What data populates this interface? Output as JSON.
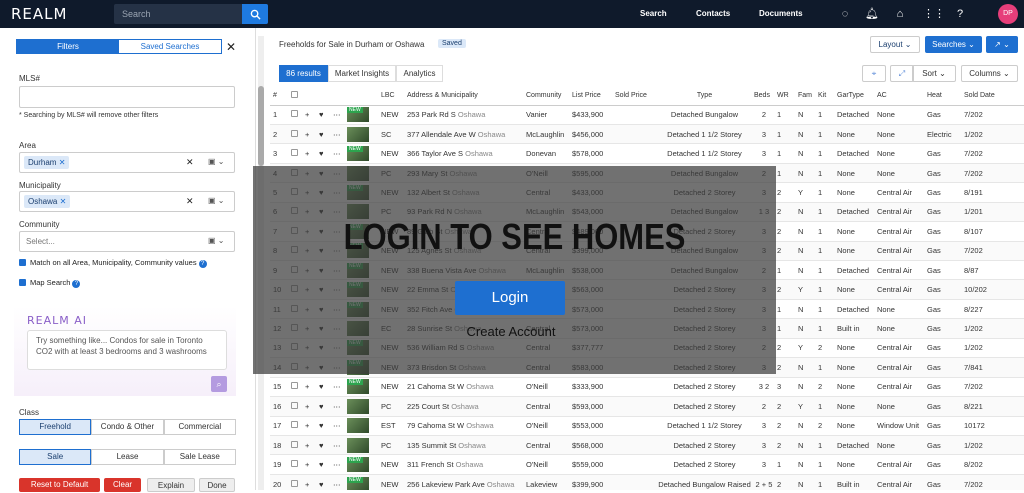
{
  "top": {
    "logo": "REALM",
    "search_placeholder": "Search",
    "nav_search": "Search",
    "nav_contacts": "Contacts",
    "nav_documents": "Documents",
    "avatar": "DP"
  },
  "left": {
    "tab_filters": "Filters",
    "tab_saved": "Saved Searches",
    "mls_label": "MLS#",
    "mls_note": "* Searching by MLS# will remove other filters",
    "area_label": "Area",
    "area_chip": "Durham",
    "muni_label": "Municipality",
    "muni_chip": "Oshawa",
    "community_label": "Community",
    "community_placeholder": "Select...",
    "match_text": "Match on all Area, Municipality, Community values",
    "map_search": "Map Search",
    "ai_logo": "REALM AI",
    "ai_prompt": "Try something like... Condos for sale in Toronto CO2 with at least 3 bedrooms and 3 washrooms",
    "class_label": "Class",
    "class_opts": [
      "Freehold",
      "Condo & Other",
      "Commercial"
    ],
    "sale_opts": [
      "Sale",
      "Lease",
      "Sale Lease"
    ],
    "btn_reset": "Reset to Default",
    "btn_clear": "Clear",
    "btn_explain": "Explain",
    "btn_done": "Done"
  },
  "right": {
    "title": "Freeholds for Sale in Durham or Oshawa",
    "saved_badge": "Saved",
    "layout_btn": "Layout",
    "searches_btn": "Searches",
    "sort_btn": "Sort",
    "columns_btn": "Columns",
    "tab_results": "86 results",
    "tab_market": "Market Insights",
    "tab_analytics": "Analytics"
  },
  "table": {
    "headers": [
      "#",
      "",
      "",
      "",
      "",
      "LBC",
      "Address & Municipality",
      "Community",
      "List Price",
      "Sold Price",
      "Type",
      "Beds",
      "WR",
      "Fam",
      "Kit",
      "GarType",
      "AC",
      "Heat",
      "Sold Date"
    ],
    "rows": [
      [
        "1",
        "NEW",
        "253 Park Rd S",
        "Oshawa",
        "Vanier",
        "$433,900",
        "",
        "Detached Bungalow",
        "2",
        "1",
        "N",
        "1",
        "Detached",
        "None",
        "Gas",
        "7/202"
      ],
      [
        "2",
        "SC",
        "377 Allendale Ave W",
        "Oshawa",
        "McLaughlin",
        "$456,000",
        "",
        "Detached 1 1/2 Storey",
        "3",
        "1",
        "N",
        "1",
        "None",
        "None",
        "Electric",
        "1/202"
      ],
      [
        "3",
        "NEW",
        "366 Taylor Ave S",
        "Oshawa",
        "Donevan",
        "$578,000",
        "",
        "Detached 1 1/2 Storey",
        "3",
        "1",
        "N",
        "1",
        "Detached",
        "None",
        "Gas",
        "7/202"
      ],
      [
        "4",
        "PC",
        "293 Mary St",
        "Oshawa",
        "O'Neill",
        "$595,000",
        "",
        "Detached Bungalow",
        "2",
        "1",
        "N",
        "1",
        "None",
        "None",
        "Gas",
        "7/202"
      ],
      [
        "5",
        "NEW",
        "132 Albert St",
        "Oshawa",
        "Central",
        "$433,000",
        "",
        "Detached 2 Storey",
        "3",
        "2",
        "Y",
        "1",
        "None",
        "Central Air",
        "Gas",
        "8/191"
      ],
      [
        "6",
        "PC",
        "93 Park Rd N",
        "Oshawa",
        "McLaughlin",
        "$543,000",
        "",
        "Detached Bungalow",
        "1 3",
        "2",
        "N",
        "1",
        "Detached",
        "Central Air",
        "Gas",
        "1/201"
      ],
      [
        "7",
        "NEW",
        "89 Gibb St",
        "Oshawa",
        "Central",
        "$489,000",
        "",
        "Detached 2 Storey",
        "3",
        "2",
        "N",
        "1",
        "None",
        "Central Air",
        "Gas",
        "8/107"
      ],
      [
        "8",
        "NEW",
        "125 Agnes St",
        "Oshawa",
        "Central",
        "$399,000",
        "",
        "Detached Bungalow",
        "3",
        "2",
        "N",
        "1",
        "None",
        "Central Air",
        "Gas",
        "7/202"
      ],
      [
        "9",
        "NEW",
        "338 Buena Vista Ave",
        "Oshawa",
        "McLaughlin",
        "$538,000",
        "",
        "Detached Bungalow",
        "2",
        "1",
        "N",
        "1",
        "Detached",
        "Central Air",
        "Gas",
        "8/87"
      ],
      [
        "10",
        "NEW",
        "22 Emma St",
        "Oshawa",
        "O'Neill",
        "$563,000",
        "",
        "Detached 2 Storey",
        "3",
        "2",
        "Y",
        "1",
        "None",
        "Central Air",
        "Gas",
        "10/202"
      ],
      [
        "11",
        "NEW",
        "352 Fitch Ave",
        "Oshawa",
        "O'Neill",
        "$573,000",
        "",
        "Detached 2 Storey",
        "3",
        "1",
        "N",
        "1",
        "Detached",
        "None",
        "Gas",
        "8/227"
      ],
      [
        "12",
        "EC",
        "28 Sunrise St",
        "Oshawa",
        "Central",
        "$573,000",
        "",
        "Detached 2 Storey",
        "3",
        "1",
        "N",
        "1",
        "Built in",
        "None",
        "Gas",
        "1/202"
      ],
      [
        "13",
        "NEW",
        "536 William Rd S",
        "Oshawa",
        "Central",
        "$377,777",
        "",
        "Detached 2 Storey",
        "2",
        "2",
        "Y",
        "2",
        "None",
        "Central Air",
        "Gas",
        "1/202"
      ],
      [
        "14",
        "NEW",
        "373 Brisdon St",
        "Oshawa",
        "Central",
        "$583,000",
        "",
        "Detached 2 Storey",
        "3",
        "2",
        "N",
        "1",
        "None",
        "Central Air",
        "Gas",
        "7/841"
      ],
      [
        "15",
        "NEW",
        "21 Cahoma St W",
        "Oshawa",
        "O'Neill",
        "$333,900",
        "",
        "Detached 2 Storey",
        "3 2",
        "3",
        "N",
        "2",
        "None",
        "Central Air",
        "Gas",
        "7/202"
      ],
      [
        "16",
        "PC",
        "225 Court St",
        "Oshawa",
        "Central",
        "$593,000",
        "",
        "Detached 2 Storey",
        "2",
        "2",
        "Y",
        "1",
        "None",
        "None",
        "Gas",
        "8/221"
      ],
      [
        "17",
        "EST",
        "79 Cahoma St W",
        "Oshawa",
        "O'Neill",
        "$553,000",
        "",
        "Detached 1 1/2 Storey",
        "3",
        "2",
        "N",
        "2",
        "None",
        "Window Unit",
        "Gas",
        "10172"
      ],
      [
        "18",
        "PC",
        "135 Summit St",
        "Oshawa",
        "Central",
        "$568,000",
        "",
        "Detached 2 Storey",
        "3",
        "2",
        "N",
        "1",
        "Detached",
        "None",
        "Gas",
        "1/202"
      ],
      [
        "19",
        "NEW",
        "311 French St",
        "Oshawa",
        "O'Neill",
        "$559,000",
        "",
        "Detached 2 Storey",
        "3",
        "1",
        "N",
        "1",
        "None",
        "Central Air",
        "Gas",
        "8/202"
      ],
      [
        "20",
        "NEW",
        "256 Lakeview Park Ave",
        "Oshawa",
        "Lakeview",
        "$399,900",
        "",
        "Detached Bungalow Raised",
        "2 + 5",
        "2",
        "N",
        "1",
        "Built in",
        "Central Air",
        "Gas",
        "7/202"
      ]
    ]
  },
  "overlay": {
    "title": "LOGIN TO SEE HOMES",
    "login": "Login",
    "create": "Create Account"
  }
}
